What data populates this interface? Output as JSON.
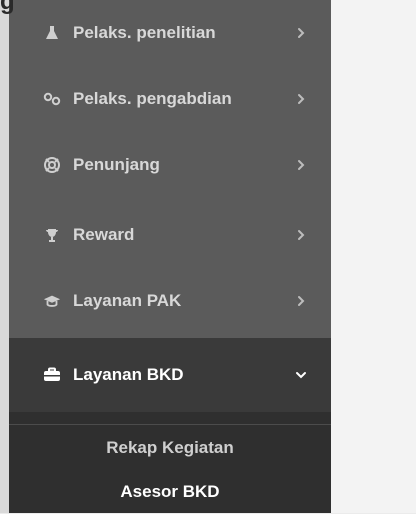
{
  "sidebar": {
    "items": [
      {
        "label": "Pelaks. penelitian",
        "icon": "flask-icon",
        "expanded": false
      },
      {
        "label": "Pelaks. pengabdian",
        "icon": "link-icon",
        "expanded": false
      },
      {
        "label": "Penunjang",
        "icon": "lifebuoy-icon",
        "expanded": false
      },
      {
        "label": "Reward",
        "icon": "trophy-icon",
        "expanded": false
      },
      {
        "label": "Layanan PAK",
        "icon": "graduation-cap-icon",
        "expanded": false
      },
      {
        "label": "Layanan BKD",
        "icon": "briefcase-icon",
        "expanded": true
      }
    ],
    "submenu": {
      "items": [
        {
          "label": "Rekap Kegiatan"
        },
        {
          "label": "Asesor BKD"
        }
      ]
    }
  }
}
